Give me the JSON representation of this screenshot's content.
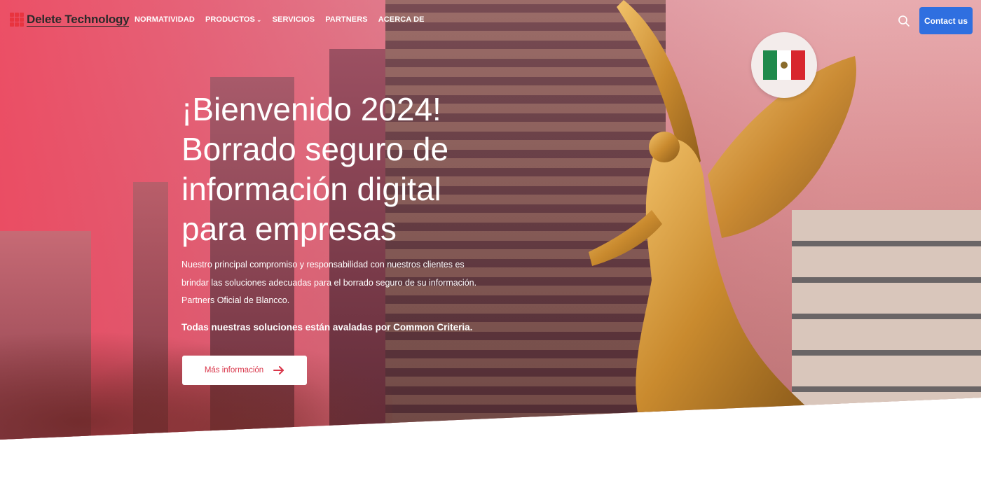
{
  "brand": {
    "name": "Delete Technology",
    "accent": "#e8343f"
  },
  "nav": {
    "items": [
      {
        "label": "NORMATIVIDAD",
        "dropdown": false
      },
      {
        "label": "PRODUCTOS",
        "dropdown": true
      },
      {
        "label": "SERVICIOS",
        "dropdown": false
      },
      {
        "label": "PARTNERS",
        "dropdown": false
      },
      {
        "label": "ACERCA DE",
        "dropdown": false
      }
    ],
    "search_icon": "search-icon",
    "contact_label": "Contact us",
    "contact_color": "#2f6fe0"
  },
  "hero": {
    "title_lines": [
      "¡Bienvenido 2024!",
      "Borrado seguro de",
      "información digital",
      "para empresas"
    ],
    "description": "Nuestro principal compromiso y responsabilidad con nuestros clientes es brindar las soluciones adecuadas para el borrado seguro de su información. Partners Oficial de Blancco.",
    "emphasis": "Todas nuestras soluciones están avaladas por Common Criteria.",
    "cta_label": "Más información",
    "cta_icon": "arrow-right-icon",
    "cta_color": "#d9364a",
    "flag_icon": "mexico-flag-icon"
  }
}
